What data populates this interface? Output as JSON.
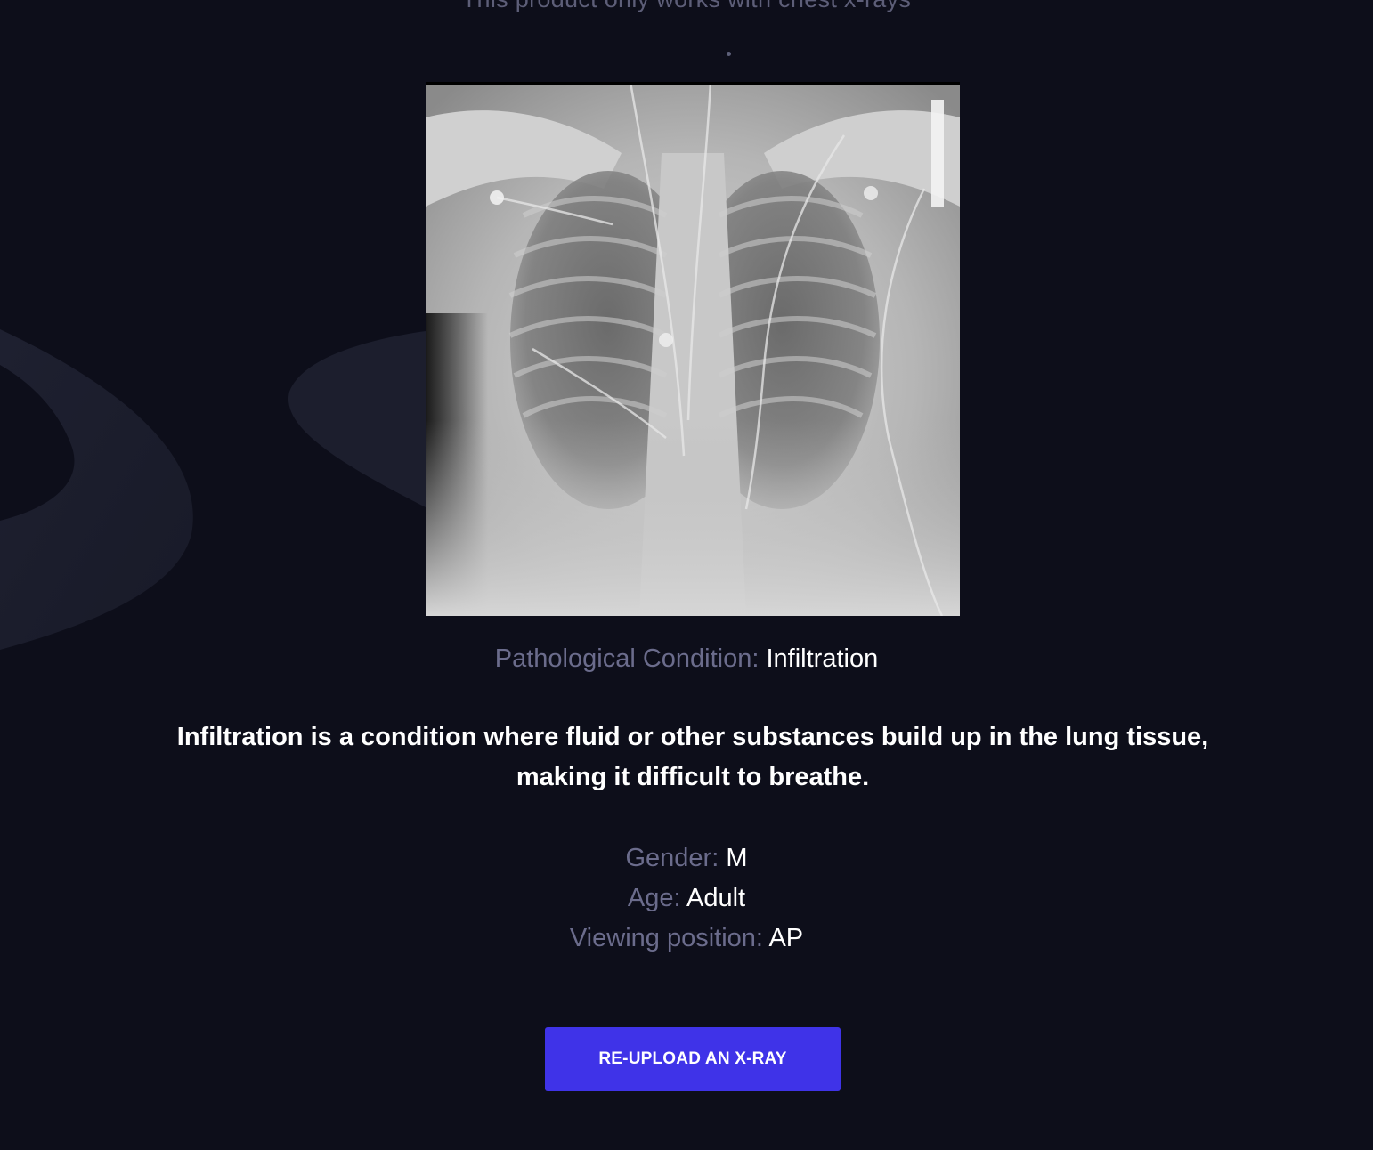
{
  "header": {
    "note": "This product only works with chest x-rays"
  },
  "image": {
    "alt": "Uploaded chest x-ray"
  },
  "result": {
    "condition_label": "Pathological Condition:",
    "condition_value": "Infiltration",
    "description": "Infiltration is a condition where fluid or other substances build up in the lung tissue, making it difficult to breathe."
  },
  "metadata": [
    {
      "label": "Gender:",
      "value": "M"
    },
    {
      "label": "Age:",
      "value": "Adult"
    },
    {
      "label": "Viewing position:",
      "value": "AP"
    }
  ],
  "actions": {
    "reupload_label": "RE-UPLOAD AN X-RAY"
  },
  "colors": {
    "background": "#0d0e1a",
    "muted_text": "#6b6c8c",
    "accent": "#3f33e8"
  }
}
